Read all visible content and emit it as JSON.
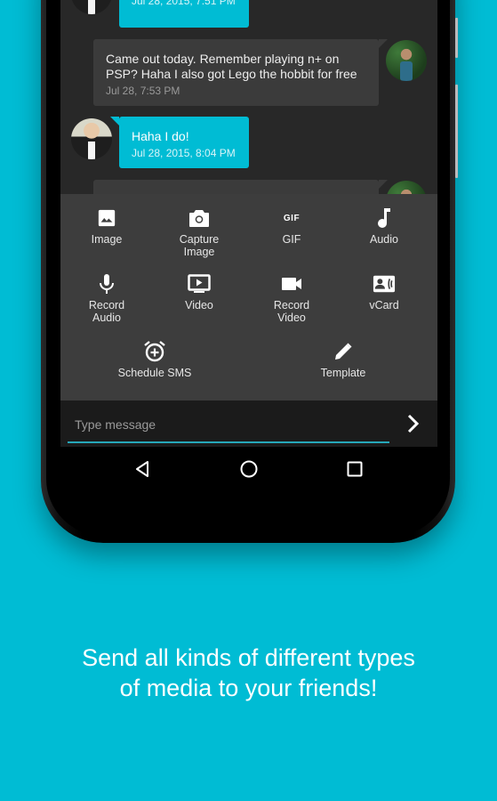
{
  "colors": {
    "background": "#00bcd4",
    "sent_bubble": "#00bcd4",
    "received_bubble": "#3b3b3b",
    "chat_background": "#282828",
    "attach_panel": "#3d3d3d",
    "input_underline": "#26a6b8"
  },
  "messages": [
    {
      "direction": "sent",
      "text": "",
      "time": "Jul 28, 2015, 7:51 PM",
      "avatar": "me-avatar"
    },
    {
      "direction": "received",
      "text": "Came out today. Remember playing n+ on PSP? Haha I also got Lego the hobbit for free",
      "time": "Jul 28, 7:53 PM",
      "avatar": "friend-avatar"
    },
    {
      "direction": "sent",
      "text": "Haha I do!",
      "time": "Jul 28, 2015, 8:04 PM",
      "avatar": "me-avatar"
    },
    {
      "direction": "received",
      "text": "",
      "time": "",
      "avatar": "friend-avatar"
    }
  ],
  "attachments": [
    {
      "label": "Image",
      "icon": "image-icon"
    },
    {
      "label": "Capture\nImage",
      "icon": "camera-icon"
    },
    {
      "label": "GIF",
      "icon": "gif-icon",
      "icon_text": "GIF"
    },
    {
      "label": "Audio",
      "icon": "music-note-icon"
    },
    {
      "label": "Record\nAudio",
      "icon": "microphone-icon"
    },
    {
      "label": "Video",
      "icon": "video-play-icon"
    },
    {
      "label": "Record\nVideo",
      "icon": "video-camera-icon"
    },
    {
      "label": "vCard",
      "icon": "contact-card-icon"
    },
    {
      "label": "Schedule SMS",
      "icon": "alarm-add-icon"
    },
    {
      "label": "Template",
      "icon": "pencil-icon"
    }
  ],
  "composer": {
    "placeholder": "Type message",
    "value": "",
    "send_icon": "chevron-right-icon"
  },
  "navbar": {
    "back_icon": "back-triangle-icon",
    "home_icon": "home-circle-icon",
    "recents_icon": "recents-square-icon"
  },
  "tagline": "Send all kinds of different types\nof media to your friends!"
}
